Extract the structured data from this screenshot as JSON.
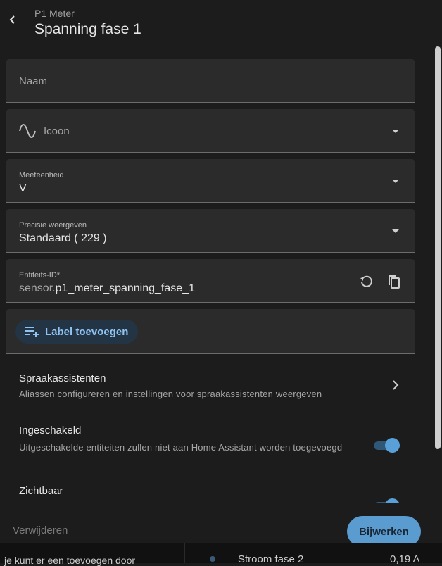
{
  "header": {
    "subtitle": "P1 Meter",
    "title": "Spanning fase 1"
  },
  "fields": {
    "name": {
      "label": "Naam"
    },
    "icon": {
      "label": "Icoon",
      "icon": "sine-wave-icon"
    },
    "unit": {
      "label": "Meeteenheid",
      "value": "V"
    },
    "precision": {
      "label": "Precisie weergeven",
      "value": "Standaard ( 229 )"
    },
    "entity_id": {
      "label": "Entiteits-ID*",
      "prefix": "sensor.",
      "value": "p1_meter_spanning_fase_1"
    }
  },
  "label_chip": {
    "label": "Label toevoegen"
  },
  "rows": {
    "voice": {
      "title": "Spraakassistenten",
      "description": "Aliassen configureren en instellingen voor spraakassistenten weergeven"
    },
    "enabled": {
      "title": "Ingeschakeld",
      "description": "Uitgeschakelde entiteiten zullen niet aan Home Assistant worden toegevoegd",
      "on": true
    },
    "visible": {
      "title": "Zichtbaar",
      "on": true
    }
  },
  "footer": {
    "delete_label": "Verwijderen",
    "update_label": "Bijwerken"
  },
  "background": {
    "left_text": "je kunt er een toevoegen door",
    "middle_text": "Stroom fase 2",
    "right_text": "0,19 A"
  },
  "colors": {
    "accent": "#5a9bd0",
    "surface": "#2b2b2b",
    "background": "#1c1c1c"
  }
}
